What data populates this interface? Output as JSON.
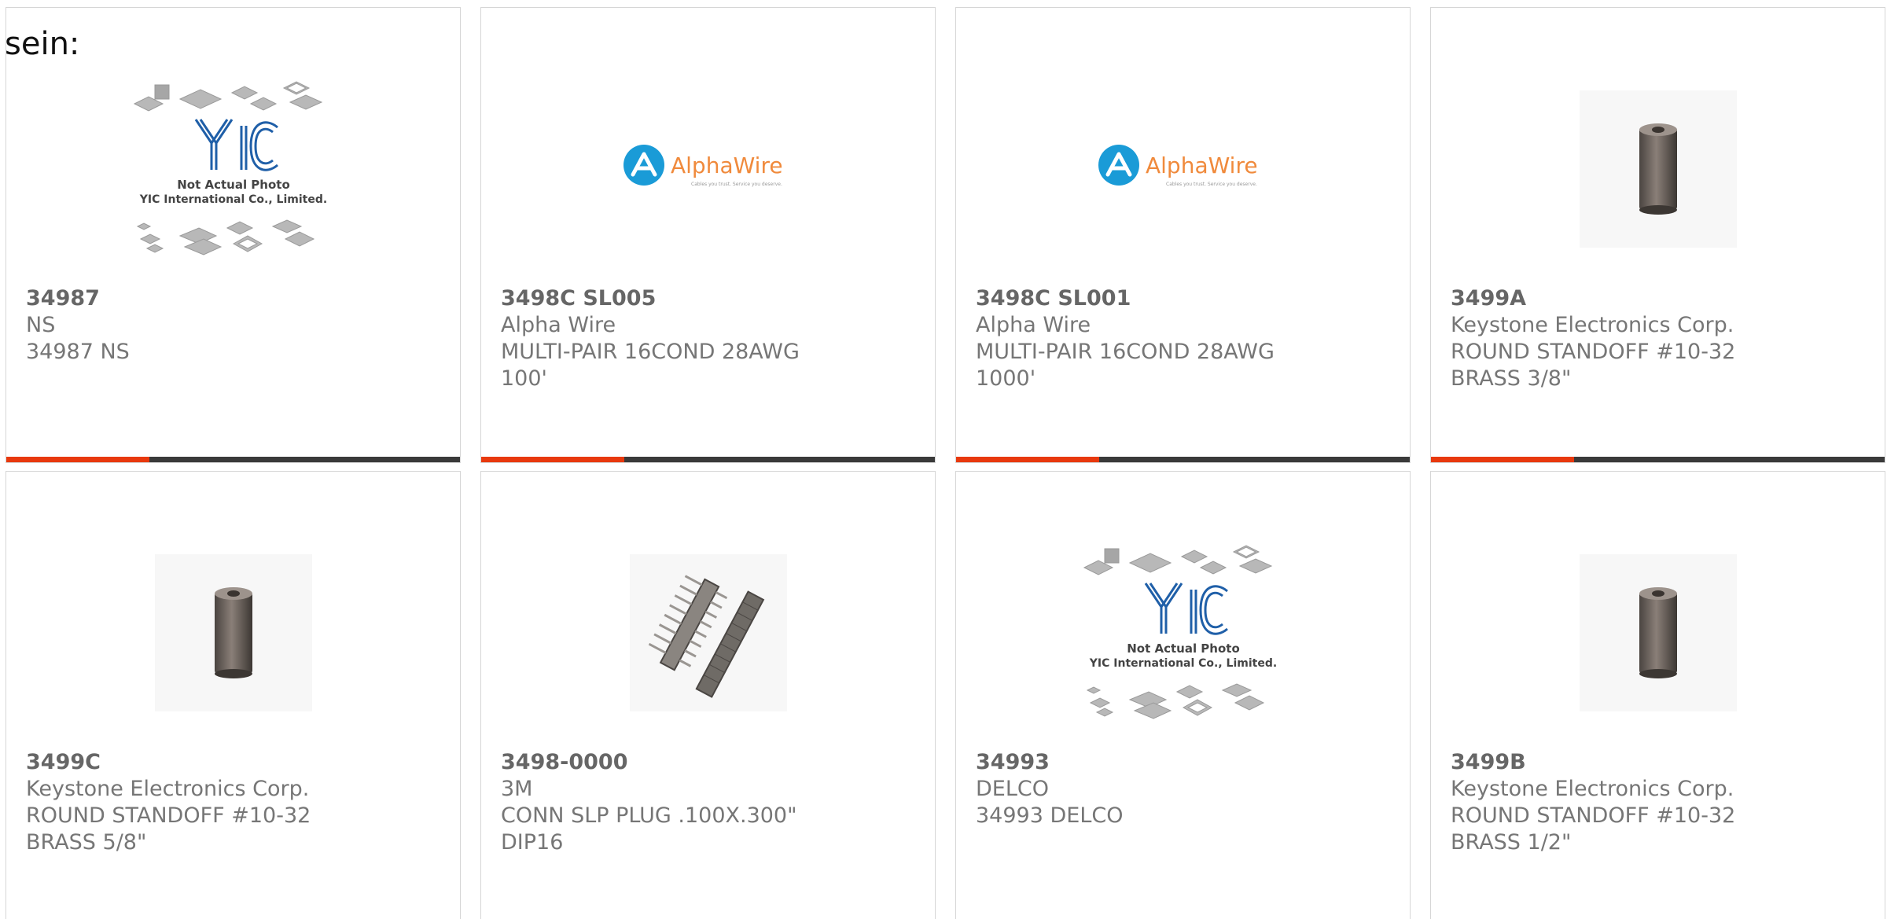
{
  "page": {
    "lead_text": "sein:"
  },
  "colors": {
    "card_border": "#d6d6d6",
    "accent_bar": "#e8390e",
    "dark_bar": "#3a3a3a",
    "text_muted": "#767676"
  },
  "products": [
    {
      "part": "34987",
      "brand": "NS",
      "desc": "34987 NS",
      "image": "yic-not-actual-photo",
      "image_caption_1": "Not Actual Photo",
      "image_caption_2": "YIC International Co., Limited."
    },
    {
      "part": "3498C SL005",
      "brand": "Alpha Wire",
      "desc": "MULTI-PAIR 16COND 28AWG\n100'",
      "image": "alphawire-logo",
      "logo_text": "AlphaWire",
      "logo_tagline": "Cables you trust. Service you deserve."
    },
    {
      "part": "3498C SL001",
      "brand": "Alpha Wire",
      "desc": "MULTI-PAIR 16COND 28AWG\n1000'",
      "image": "alphawire-logo",
      "logo_text": "AlphaWire",
      "logo_tagline": "Cables you trust. Service you deserve."
    },
    {
      "part": "3499A",
      "brand": "Keystone Electronics Corp.",
      "desc": "ROUND STANDOFF #10-32\nBRASS 3/8\"",
      "image": "standoff-photo"
    },
    {
      "part": "3499C",
      "brand": "Keystone Electronics Corp.",
      "desc": "ROUND STANDOFF #10-32\nBRASS 5/8\"",
      "image": "standoff-photo"
    },
    {
      "part": "3498-0000",
      "brand": "3M",
      "desc": "CONN SLP PLUG .100X.300\"\nDIP16",
      "image": "connector-photo"
    },
    {
      "part": "34993",
      "brand": "DELCO",
      "desc": "34993 DELCO",
      "image": "yic-not-actual-photo",
      "image_caption_1": "Not Actual Photo",
      "image_caption_2": "YIC International Co., Limited."
    },
    {
      "part": "3499B",
      "brand": "Keystone Electronics Corp.",
      "desc": "ROUND STANDOFF #10-32\nBRASS 1/2\"",
      "image": "standoff-photo"
    }
  ]
}
